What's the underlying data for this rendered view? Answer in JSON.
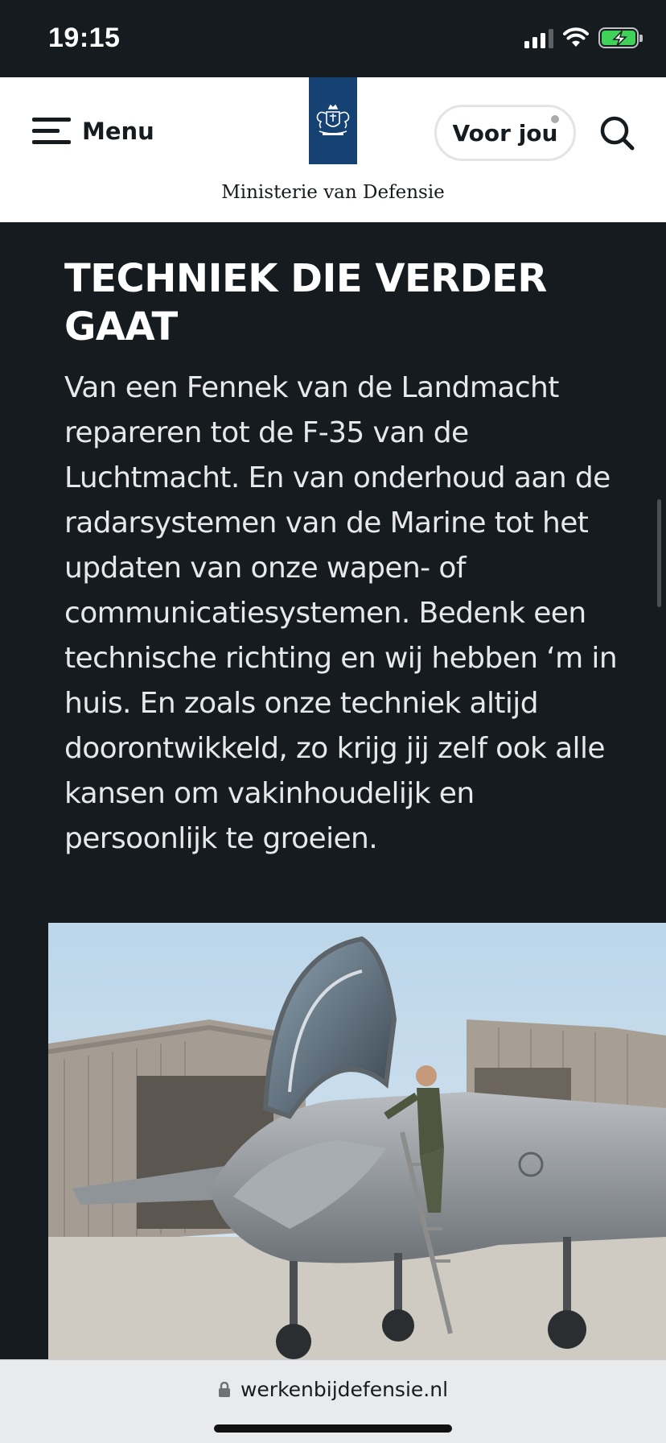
{
  "status_bar": {
    "time": "19:15"
  },
  "header": {
    "menu_label": "Menu",
    "ministry_name": "Ministerie van Defensie",
    "voor_jou_label": "Voor jou"
  },
  "content": {
    "heading": "TECHNIEK DIE VERDER GAAT",
    "body": "Van een Fennek van de Landmacht repareren tot de F-35 van de Luchtmacht. En van onderhoud aan de radarsystemen van de Marine tot het updaten van onze wapen- of communicatiesystemen. Bedenk een technische richting en wij hebben ‘m in huis. En zoals onze techniek altijd doorontwikkeld, zo krijg jij zelf ook alle kansen om vakinhoudelijk en persoonlijk te groeien."
  },
  "browser": {
    "url": "werkenbijdefensie.nl"
  },
  "colors": {
    "background": "#161b1f",
    "logo_blue": "#154273",
    "battery_green": "#3fd158"
  },
  "icons": [
    "signal-icon",
    "wifi-icon",
    "battery-icon",
    "hamburger-icon",
    "coat-of-arms-icon",
    "search-icon",
    "lock-icon"
  ]
}
